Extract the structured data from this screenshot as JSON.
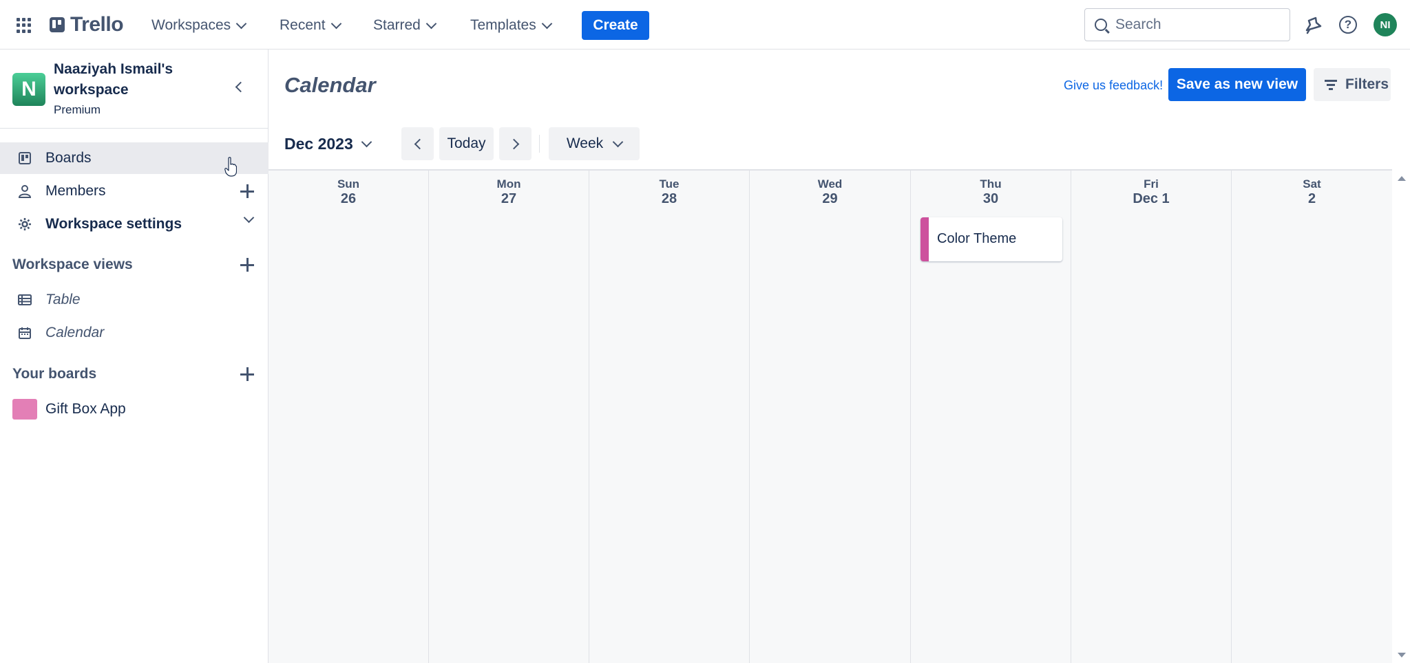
{
  "topbar": {
    "logo": "Trello",
    "nav": [
      "Workspaces",
      "Recent",
      "Starred",
      "Templates"
    ],
    "create_label": "Create",
    "search_placeholder": "Search",
    "avatar_initials": "NI"
  },
  "sidebar": {
    "workspace_initial": "N",
    "workspace_name": "Naaziyah Ismail's workspace",
    "workspace_plan": "Premium",
    "items": [
      {
        "label": "Boards",
        "icon": "board-icon"
      },
      {
        "label": "Members",
        "icon": "person-icon"
      },
      {
        "label": "Workspace settings",
        "icon": "gear-icon"
      }
    ],
    "views_heading": "Workspace views",
    "views": [
      {
        "label": "Table",
        "icon": "table-icon"
      },
      {
        "label": "Calendar",
        "icon": "calendar-icon"
      }
    ],
    "boards_heading": "Your boards",
    "boards": [
      {
        "label": "Gift Box App",
        "color": "#e37fb6"
      }
    ]
  },
  "main": {
    "title": "Calendar",
    "feedback_label": "Give us feedback!",
    "save_view_label": "Save as new view",
    "filters_label": "Filters",
    "month_label": "Dec 2023",
    "today_label": "Today",
    "range_label": "Week",
    "days": [
      {
        "name": "Sun",
        "num": "26"
      },
      {
        "name": "Mon",
        "num": "27"
      },
      {
        "name": "Tue",
        "num": "28"
      },
      {
        "name": "Wed",
        "num": "29"
      },
      {
        "name": "Thu",
        "num": "30"
      },
      {
        "name": "Fri",
        "num": "Dec 1"
      },
      {
        "name": "Sat",
        "num": "2"
      }
    ],
    "event": {
      "title": "Color Theme",
      "day": "Thu",
      "color": "#cd519d"
    }
  },
  "colors": {
    "brand": "#0c66e4",
    "workspace_tile": "#1f845a",
    "avatar": "#1f845a"
  }
}
